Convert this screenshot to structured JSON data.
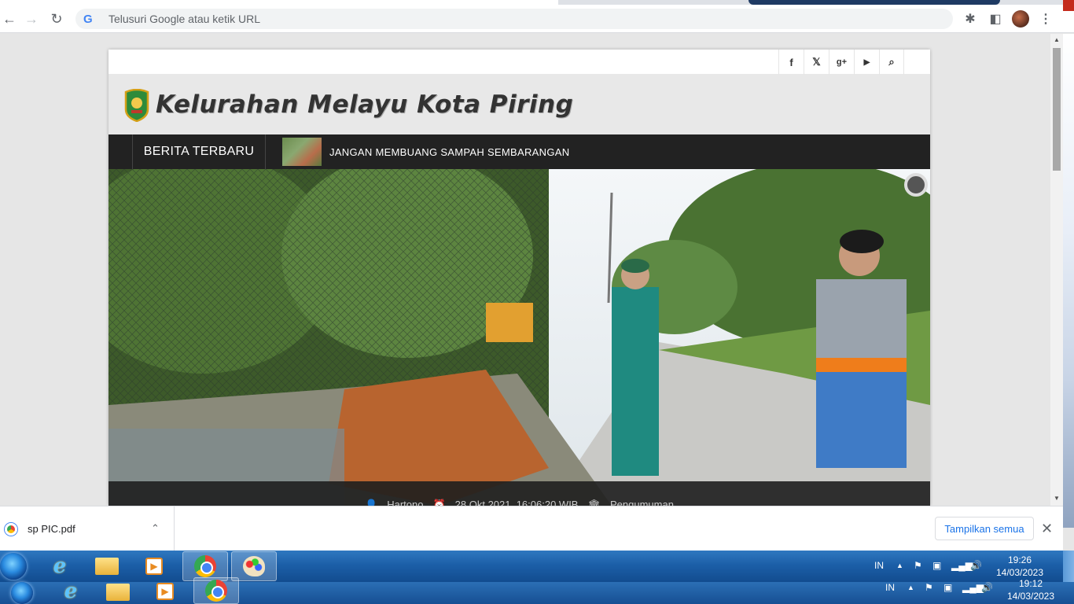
{
  "browser": {
    "omnibox_placeholder": "Telusuri Google atau ketik URL",
    "google_glyph": "G",
    "icons": [
      "back-icon",
      "forward-icon",
      "reload-icon",
      "extensions-icon",
      "side-panel-icon",
      "profile-avatar",
      "menu-icon"
    ]
  },
  "site": {
    "title": "Kelurahan Melayu Kota Piring",
    "social": [
      "f",
      "𝕏",
      "g+",
      "▶",
      "⌕"
    ],
    "ticker_label": "BERITA TERBARU",
    "ticker_headline": "JANGAN MEMBUANG SAMPAH SEMBARANGAN",
    "caption": {
      "author": "Hartono",
      "date": "28 Okt 2021, 16:06:20 WIB",
      "category": "Pengumuman"
    }
  },
  "downloads": {
    "file_name": "sp PIC.pdf",
    "show_all": "Tampilkan semua",
    "close": "✕"
  },
  "taskbar": {
    "lang": "IN",
    "time_1": "19:26",
    "date_1": "14/03/2023",
    "time_2": "19:12",
    "date_2": "14/03/2023"
  }
}
